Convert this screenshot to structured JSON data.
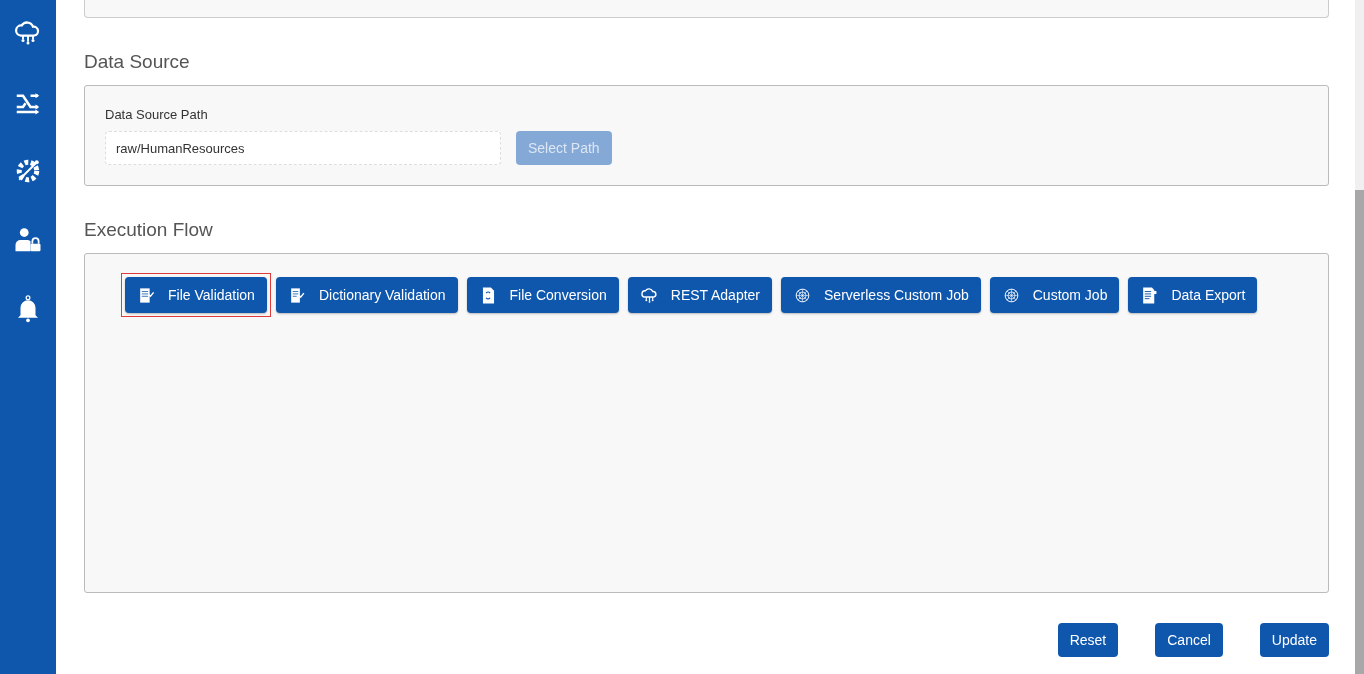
{
  "sidebar": {
    "items": [
      {
        "kind": "cloud"
      },
      {
        "kind": "shuffle"
      },
      {
        "kind": "gear"
      },
      {
        "kind": "user-lock"
      },
      {
        "kind": "bell"
      }
    ]
  },
  "data_source": {
    "heading": "Data Source",
    "label": "Data Source Path",
    "value": "raw/HumanResources",
    "button": {
      "label": "Select Path",
      "disabled": true
    }
  },
  "execution_flow": {
    "heading": "Execution Flow",
    "steps": [
      {
        "label": "File Validation",
        "kind": "file-check",
        "focused": true
      },
      {
        "label": "Dictionary Validation",
        "kind": "list-check",
        "focused": false
      },
      {
        "label": "File Conversion",
        "kind": "file-convert",
        "focused": false
      },
      {
        "label": "REST Adapter",
        "kind": "cloud",
        "focused": false
      },
      {
        "label": "Serverless Custom Job",
        "kind": "globe",
        "focused": false
      },
      {
        "label": "Custom Job",
        "kind": "globe",
        "focused": false
      },
      {
        "label": "Data Export",
        "kind": "file-export",
        "focused": false
      }
    ]
  },
  "actions": [
    "Reset",
    "Cancel",
    "Update"
  ]
}
